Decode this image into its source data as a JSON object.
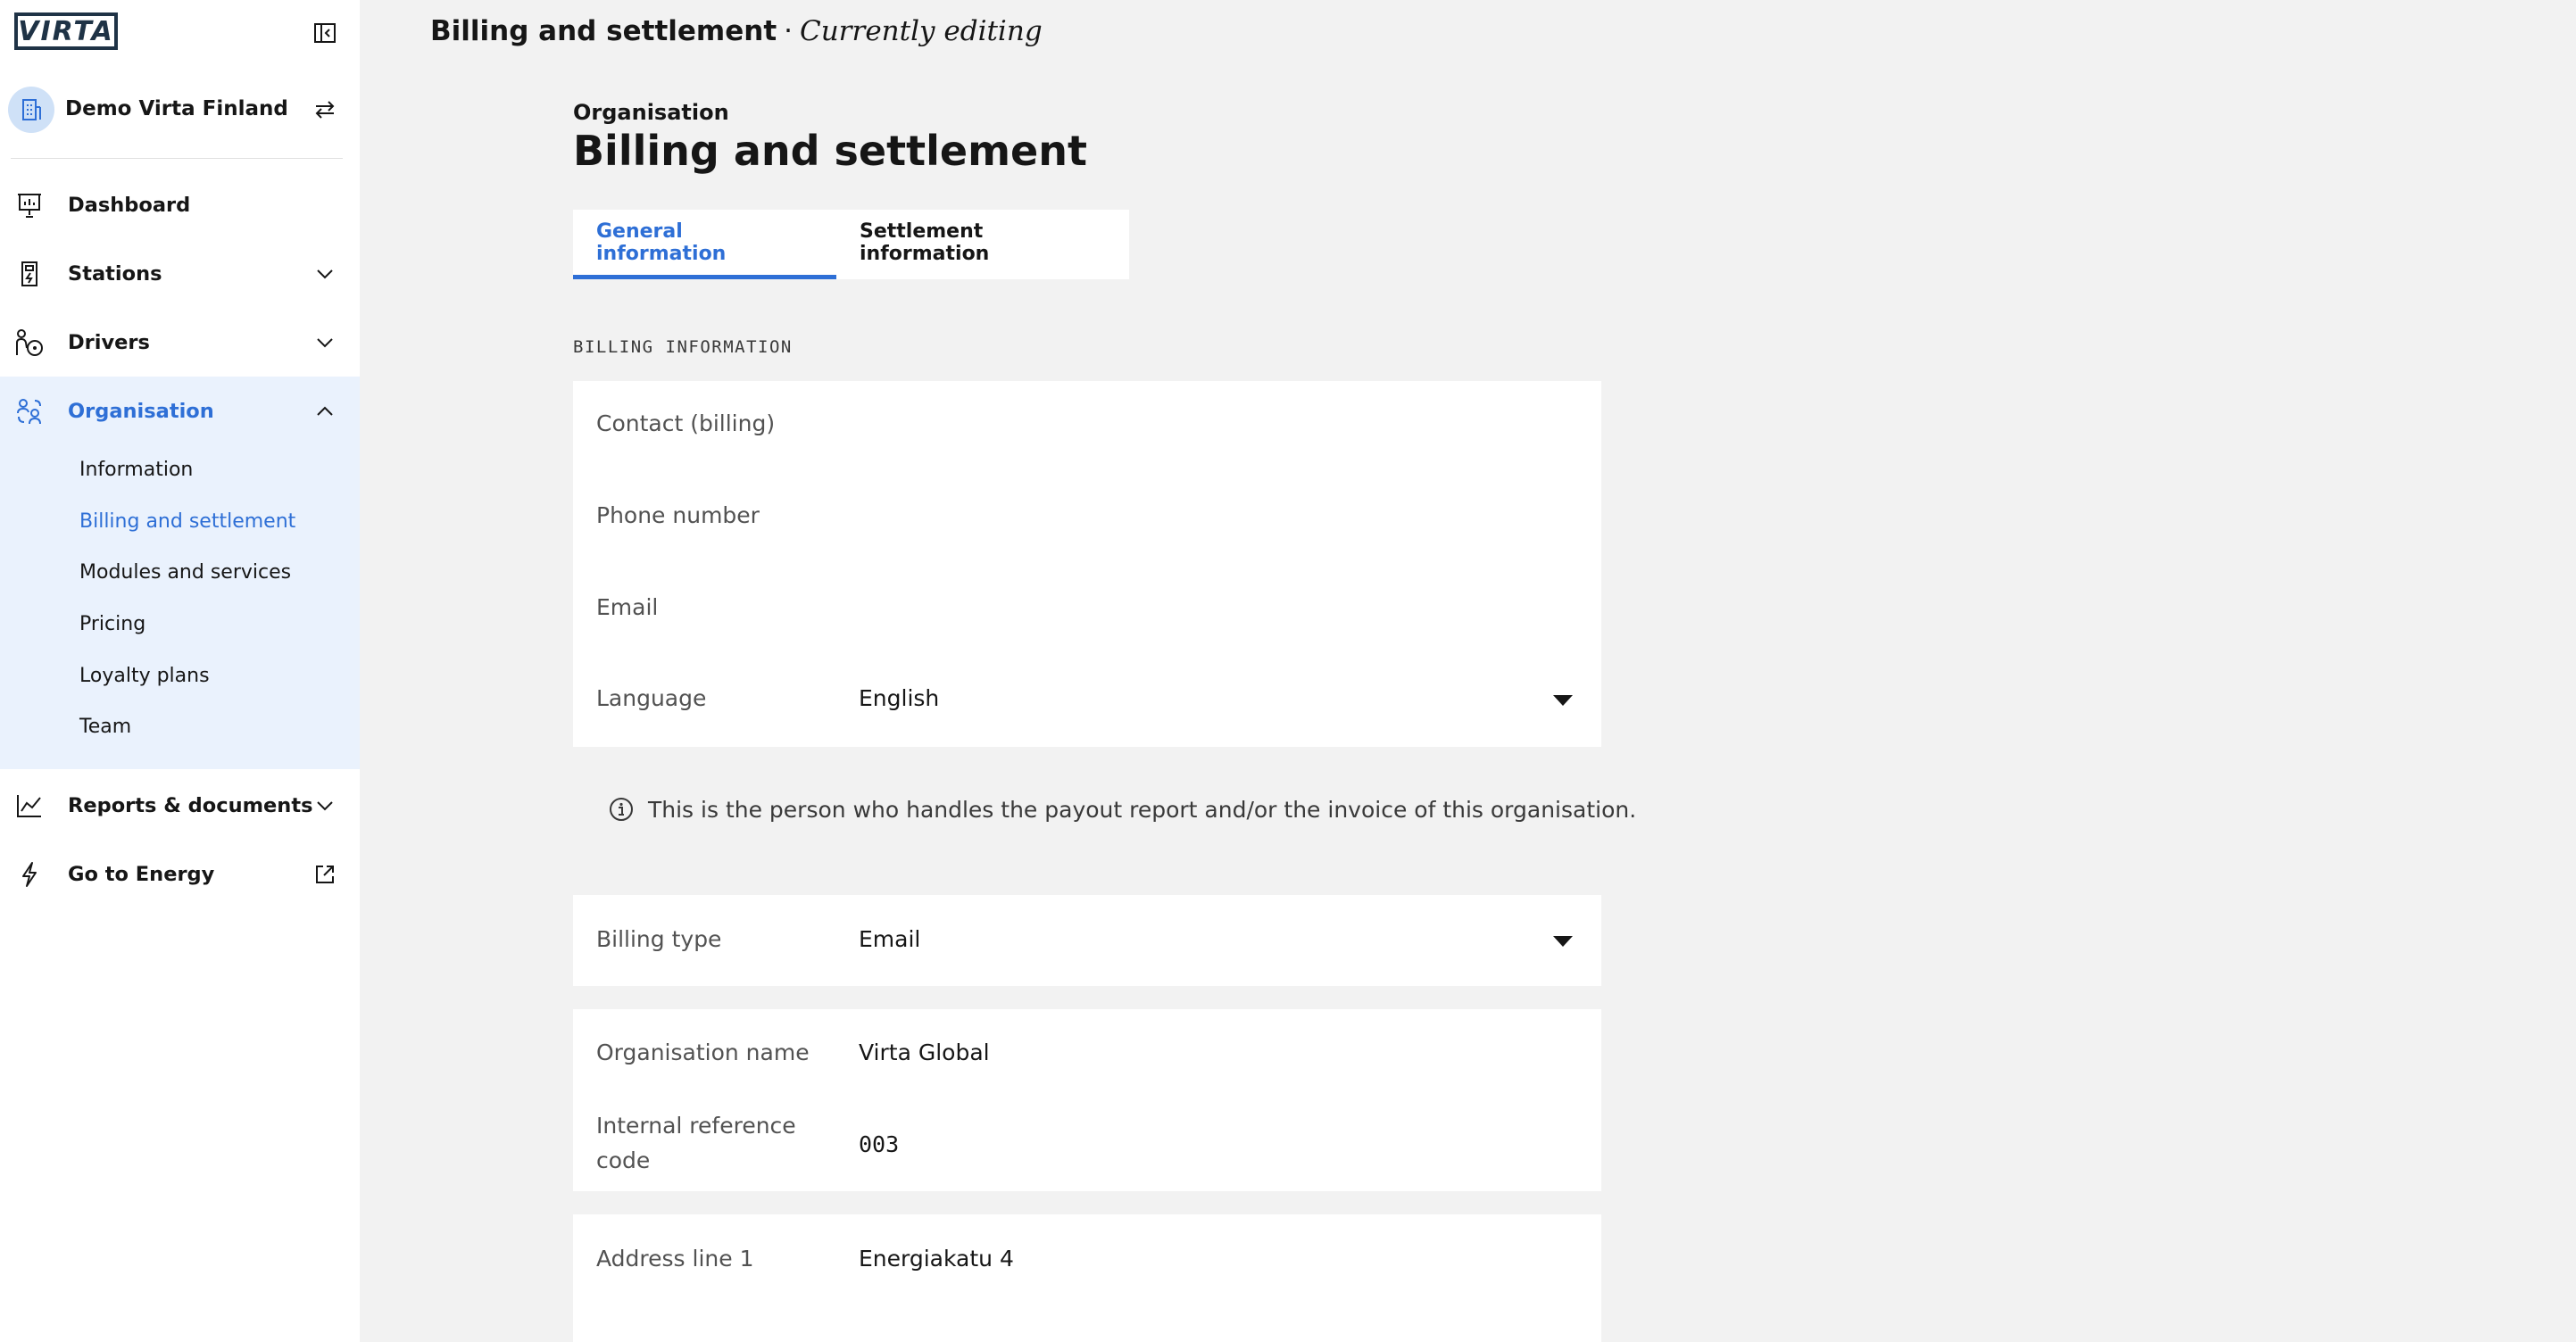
{
  "app": {
    "logo_text": "VIRTA"
  },
  "sidebar": {
    "organisation_name": "Demo Virta Finland",
    "nav": [
      {
        "label": "Dashboard",
        "icon": "dashboard-icon"
      },
      {
        "label": "Stations",
        "icon": "station-icon"
      },
      {
        "label": "Drivers",
        "icon": "drivers-icon"
      },
      {
        "label": "Organisation",
        "icon": "organisation-icon"
      },
      {
        "label": "Reports & documents",
        "icon": "chart-icon"
      },
      {
        "label": "Go to Energy",
        "icon": "bolt-icon"
      }
    ],
    "organisation_sub": [
      {
        "label": "Information"
      },
      {
        "label": "Billing and settlement"
      },
      {
        "label": "Modules and services"
      },
      {
        "label": "Pricing"
      },
      {
        "label": "Loyalty plans"
      },
      {
        "label": "Team"
      }
    ]
  },
  "header": {
    "title": "Billing and settlement",
    "separator": "·",
    "status": "Currently editing"
  },
  "page": {
    "eyebrow": "Organisation",
    "title": "Billing and settlement",
    "tabs": [
      {
        "label": "General information",
        "active": true
      },
      {
        "label": "Settlement information",
        "active": false
      }
    ],
    "section_label": "BILLING INFORMATION",
    "billing_card": {
      "contact_label": "Contact (billing)",
      "phone_label": "Phone number",
      "email_label": "Email",
      "language_label": "Language",
      "language_value": "English"
    },
    "hint": "This is the person who handles the payout report and/or the invoice of this organisation.",
    "billing_type": {
      "label": "Billing type",
      "value": "Email"
    },
    "org_card": {
      "org_name_label": "Organisation name",
      "org_name_value": "Virta Global",
      "ref_label_line1": "Internal reference",
      "ref_label_line2": "code",
      "ref_value": "003"
    },
    "address_card": {
      "address1_label": "Address line 1",
      "address1_value": "Energiakatu 4"
    }
  },
  "colors": {
    "accent": "#2e6fd6",
    "background": "#f2f2f2",
    "active_section_bg": "#eaf2fd"
  }
}
